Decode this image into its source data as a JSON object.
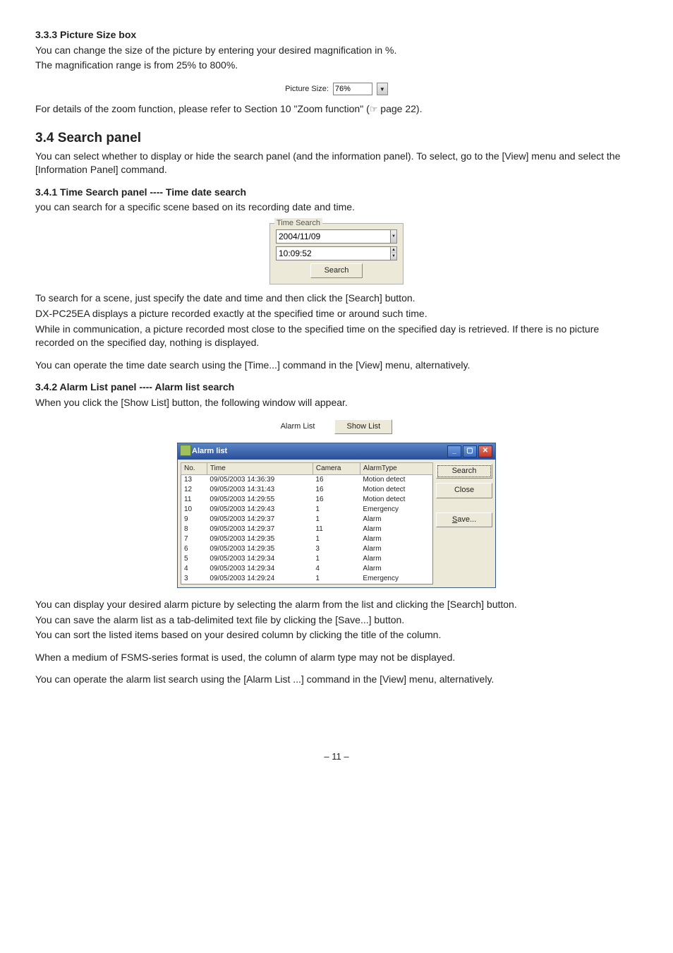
{
  "s333": {
    "heading": "3.3.3 Picture Size box",
    "p1": "You can change the size of the picture by entering your desired magnification in %.",
    "p2": "The magnification range is from 25% to 800%.",
    "widget": {
      "label": "Picture Size:",
      "value": "76%"
    },
    "p3a": "For details of the zoom function, please refer to Section 10 \"Zoom function\" (",
    "p3b": " page 22)."
  },
  "s34": {
    "heading": "3.4 Search panel",
    "p1": "You can select whether to display or hide the search panel (and the information panel). To select, go to the [View] menu and select the [Information Panel] command."
  },
  "s341": {
    "heading": "3.4.1 Time Search panel ---- Time date search",
    "p1": "you can search for a specific scene based on its recording date and time.",
    "widget": {
      "legend": "Time Search",
      "date": "2004/11/09",
      "time": "10:09:52",
      "button": "Search"
    },
    "p2": "To search for a scene, just specify the date and time and then click the [Search] button.",
    "p3": "DX-PC25EA displays a picture recorded exactly at the specified time or around such time.",
    "p4": "While in communication, a picture recorded most close to the specified time on the specified day is retrieved. If there is no picture recorded on the specified day, nothing is displayed.",
    "p5": "You can operate the time date search using the [Time...] command in the [View] menu, alternatively."
  },
  "s342": {
    "heading": "3.4.2 Alarm List panel ---- Alarm list search",
    "p1": "When you click the [Show List] button, the following window will appear.",
    "bar": {
      "label": "Alarm List",
      "button": "Show List"
    },
    "window": {
      "title": "Alarm list",
      "cols": {
        "no": "No.",
        "time": "Time",
        "camera": "Camera",
        "type": "AlarmType"
      },
      "rows": [
        {
          "no": "13",
          "time": "09/05/2003 14:36:39",
          "camera": "16",
          "type": "Motion detect"
        },
        {
          "no": "12",
          "time": "09/05/2003 14:31:43",
          "camera": "16",
          "type": "Motion detect"
        },
        {
          "no": "11",
          "time": "09/05/2003 14:29:55",
          "camera": "16",
          "type": "Motion detect"
        },
        {
          "no": "10",
          "time": "09/05/2003 14:29:43",
          "camera": "1",
          "type": "Emergency"
        },
        {
          "no": "9",
          "time": "09/05/2003 14:29:37",
          "camera": "1",
          "type": "Alarm"
        },
        {
          "no": "8",
          "time": "09/05/2003 14:29:37",
          "camera": "11",
          "type": "Alarm"
        },
        {
          "no": "7",
          "time": "09/05/2003 14:29:35",
          "camera": "1",
          "type": "Alarm"
        },
        {
          "no": "6",
          "time": "09/05/2003 14:29:35",
          "camera": "3",
          "type": "Alarm"
        },
        {
          "no": "5",
          "time": "09/05/2003 14:29:34",
          "camera": "1",
          "type": "Alarm"
        },
        {
          "no": "4",
          "time": "09/05/2003 14:29:34",
          "camera": "4",
          "type": "Alarm"
        },
        {
          "no": "3",
          "time": "09/05/2003 14:29:24",
          "camera": "1",
          "type": "Emergency"
        }
      ],
      "buttons": {
        "search": "Search",
        "close": "Close",
        "save": "Save..."
      }
    },
    "p2": "You can display your desired alarm picture by selecting the alarm from the list and clicking the [Search] button.",
    "p3": "You can save the alarm list as a tab-delimited text file by clicking the [Save...] button.",
    "p4": "You can sort the listed items based on your desired column by clicking the title of the column.",
    "p5": "When a medium of FSMS-series format is used, the column of alarm type may not be displayed.",
    "p6": "You can operate the alarm list search using the [Alarm List ...] command in the [View] menu, alternatively."
  },
  "footer": "– 11 –"
}
